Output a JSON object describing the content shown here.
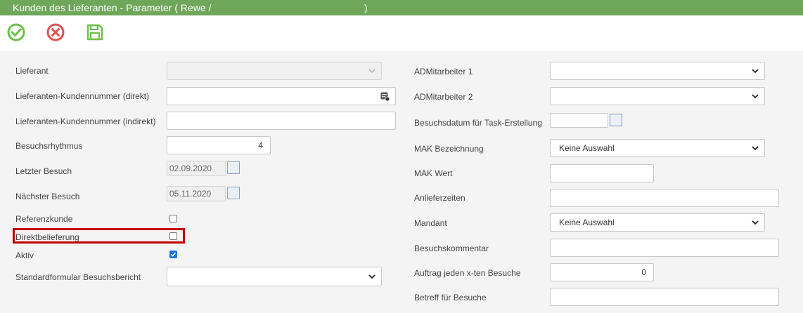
{
  "window": {
    "title": "Kunden des Lieferanten - Parameter ( Rewe /",
    "title_close": ")"
  },
  "toolbar": {
    "ok_icon": "check-circle-icon",
    "cancel_icon": "x-circle-icon",
    "save_icon": "floppy-disk-icon"
  },
  "colors": {
    "titlebar": "#6ea65a",
    "ok": "#6cc04a",
    "cancel": "#e05050",
    "save": "#6cc04a",
    "highlight": "#c00000",
    "checkbox_checked": "#1a73e8"
  },
  "left": {
    "lieferant": {
      "label": "Lieferant",
      "value": ""
    },
    "kundennr_direkt": {
      "label": "Lieferanten-Kundennummer (direkt)",
      "value": ""
    },
    "kundennr_indirekt": {
      "label": "Lieferanten-Kundennummer (indirekt)",
      "value": ""
    },
    "besuchsrhythmus": {
      "label": "Besuchsrhythmus",
      "value": "4"
    },
    "letzter_besuch": {
      "label": "Letzter Besuch",
      "value": "02.09.2020"
    },
    "naechster_besuch": {
      "label": "Nächster Besuch",
      "value": "05.11.2020"
    },
    "referenzkunde": {
      "label": "Referenzkunde",
      "checked": false
    },
    "direktbelieferung": {
      "label": "Direktbelieferung",
      "checked": false
    },
    "aktiv": {
      "label": "Aktiv",
      "checked": true
    },
    "standardformular": {
      "label": "Standardformular Besuchsbericht",
      "value": ""
    }
  },
  "right": {
    "admitarbeiter1": {
      "label": "ADMitarbeiter 1",
      "value": ""
    },
    "admitarbeiter2": {
      "label": "ADMitarbeiter 2",
      "value": ""
    },
    "besuchsdatum": {
      "label": "Besuchsdatum für Task-Erstellung",
      "value": ""
    },
    "mak_bezeichnung": {
      "label": "MAK Bezeichnung",
      "value": "Keine Auswahl"
    },
    "mak_wert": {
      "label": "MAK Wert",
      "value": ""
    },
    "anlieferzeiten": {
      "label": "Anlieferzeiten",
      "value": ""
    },
    "mandant": {
      "label": "Mandant",
      "value": "Keine Auswahl"
    },
    "besuchskommentar": {
      "label": "Besuchskommentar",
      "value": ""
    },
    "auftrag_x_ten": {
      "label": "Auftrag jeden x-ten Besuche",
      "value": "0"
    },
    "betreff": {
      "label": "Betreff für Besuche",
      "value": ""
    }
  }
}
